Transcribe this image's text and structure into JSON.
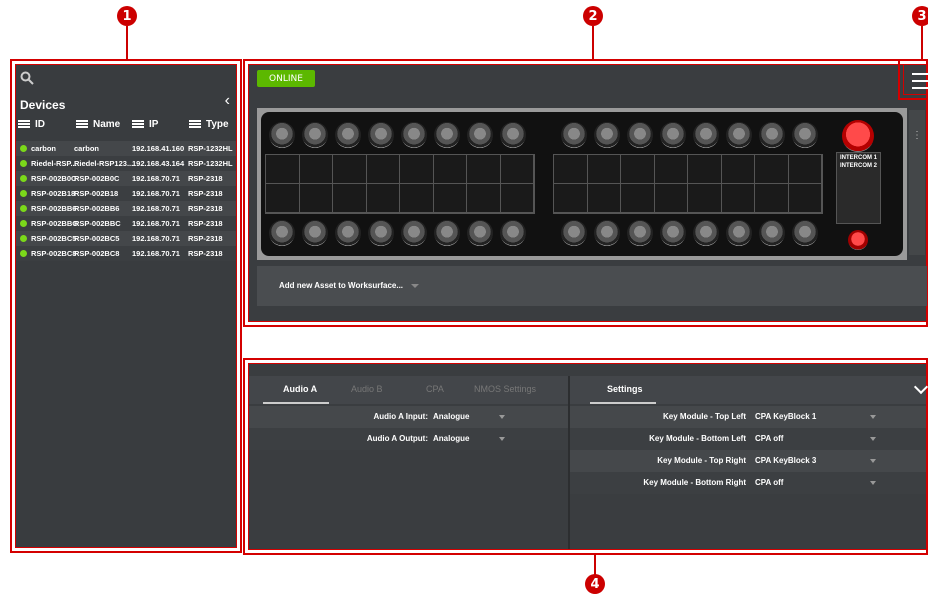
{
  "callouts": {
    "c1": "1",
    "c2": "2",
    "c3": "3",
    "c4": "4"
  },
  "colors": {
    "online": "#5cb800",
    "status_dot": "#7bd81a",
    "callout": "#cc0000"
  },
  "devices_panel": {
    "title": "Devices",
    "columns": {
      "id": "ID",
      "name": "Name",
      "ip": "IP",
      "type": "Type"
    },
    "rows": [
      {
        "id": "carbon",
        "name": "carbon",
        "ip": "192.168.41.160",
        "type": "RSP-1232HL"
      },
      {
        "id": "Riedel-RSP...",
        "name": "Riedel-RSP123...",
        "ip": "192.168.43.164",
        "type": "RSP-1232HL"
      },
      {
        "id": "RSP-002B0C",
        "name": "RSP-002B0C",
        "ip": "192.168.70.71",
        "type": "RSP-2318"
      },
      {
        "id": "RSP-002B18",
        "name": "RSP-002B18",
        "ip": "192.168.70.71",
        "type": "RSP-2318"
      },
      {
        "id": "RSP-002BB6",
        "name": "RSP-002BB6",
        "ip": "192.168.70.71",
        "type": "RSP-2318"
      },
      {
        "id": "RSP-002BBC",
        "name": "RSP-002BBC",
        "ip": "192.168.70.71",
        "type": "RSP-2318"
      },
      {
        "id": "RSP-002BC5",
        "name": "RSP-002BC5",
        "ip": "192.168.70.71",
        "type": "RSP-2318"
      },
      {
        "id": "RSP-002BC8",
        "name": "RSP-002BC8",
        "ip": "192.168.70.71",
        "type": "RSP-2318"
      }
    ]
  },
  "worksurface": {
    "status": "ONLINE",
    "intercom": [
      "INTERCOM 1",
      "INTERCOM 2"
    ],
    "add_asset_label": "Add new Asset to Worksurface..."
  },
  "config": {
    "tabs": [
      "Audio A",
      "Audio B",
      "CPA",
      "NMOS Settings"
    ],
    "settings_tab": "Settings",
    "audio_rows": [
      {
        "label": "Audio A Input:",
        "value": "Analogue"
      },
      {
        "label": "Audio A Output:",
        "value": "Analogue"
      }
    ],
    "settings_rows": [
      {
        "label": "Key Module - Top Left",
        "value": "CPA KeyBlock 1"
      },
      {
        "label": "Key Module - Bottom Left",
        "value": "CPA off"
      },
      {
        "label": "Key Module - Top Right",
        "value": "CPA KeyBlock 3"
      },
      {
        "label": "Key Module - Bottom Right",
        "value": "CPA off"
      }
    ]
  }
}
